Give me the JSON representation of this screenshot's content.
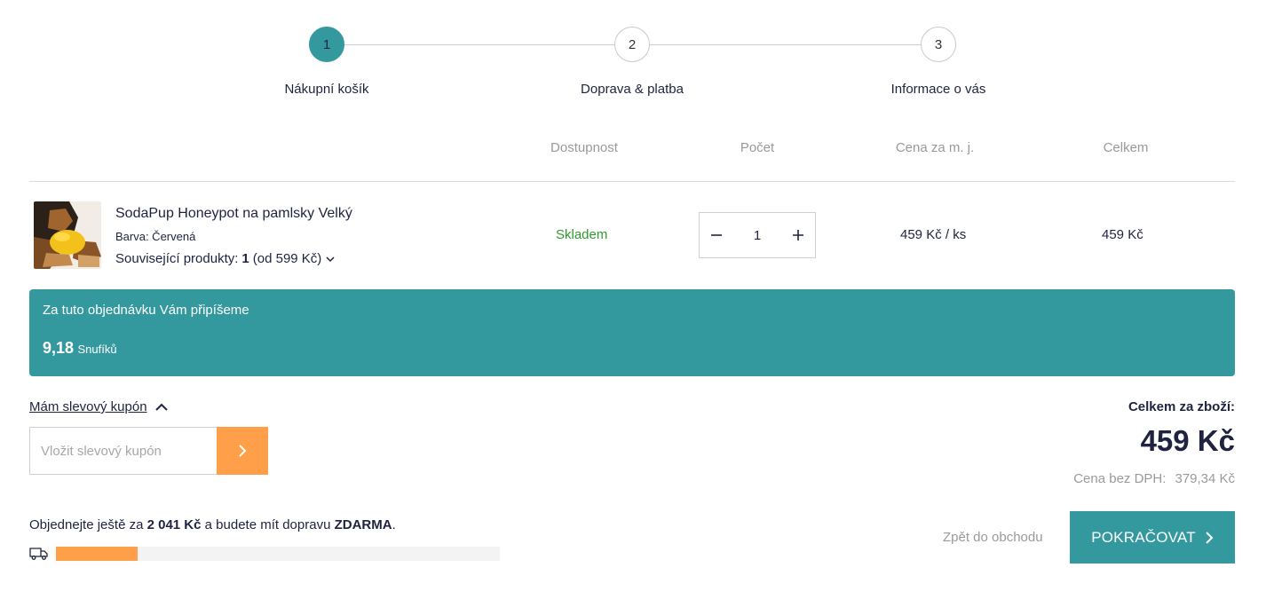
{
  "steps": [
    {
      "number": "1",
      "label": "Nákupní košík"
    },
    {
      "number": "2",
      "label": "Doprava & platba"
    },
    {
      "number": "3",
      "label": "Informace o vás"
    }
  ],
  "colors": {
    "accent": "#34999e",
    "orange": "#ff9f4a",
    "in_stock": "#2e9a2e"
  },
  "table": {
    "headers": {
      "availability": "Dostupnost",
      "quantity": "Počet",
      "unit_price": "Cena za m. j.",
      "total": "Celkem"
    }
  },
  "item": {
    "name": "SodaPup Honeypot na pamlsky Velký",
    "attribute": "Barva: Červená",
    "related_prefix": "Související produkty:",
    "related_count": "1",
    "related_suffix": "(od 599 Kč)",
    "availability": "Skladem",
    "quantity": "1",
    "unit_price": "459 Kč / ks",
    "total": "459 Kč"
  },
  "loyalty": {
    "text": "Za tuto objednávku Vám připíšeme",
    "points": "9,18",
    "unit": "Snufíků"
  },
  "coupon": {
    "toggle_label": "Mám slevový kupón",
    "placeholder": "Vložit slevový kupón"
  },
  "totals": {
    "label": "Celkem za zboží:",
    "value": "459 Kč",
    "vat_label": "Cena bez DPH:",
    "vat_value": "379,34 Kč"
  },
  "shipping": {
    "prefix": "Objednejte ještě za",
    "amount": "2 041 Kč",
    "middle": "a budete mít dopravu",
    "free": "ZDARMA",
    "suffix": ".",
    "progress": 0.184
  },
  "actions": {
    "back_label": "Zpět do obchodu",
    "continue_label": "POKRAČOVAT"
  }
}
